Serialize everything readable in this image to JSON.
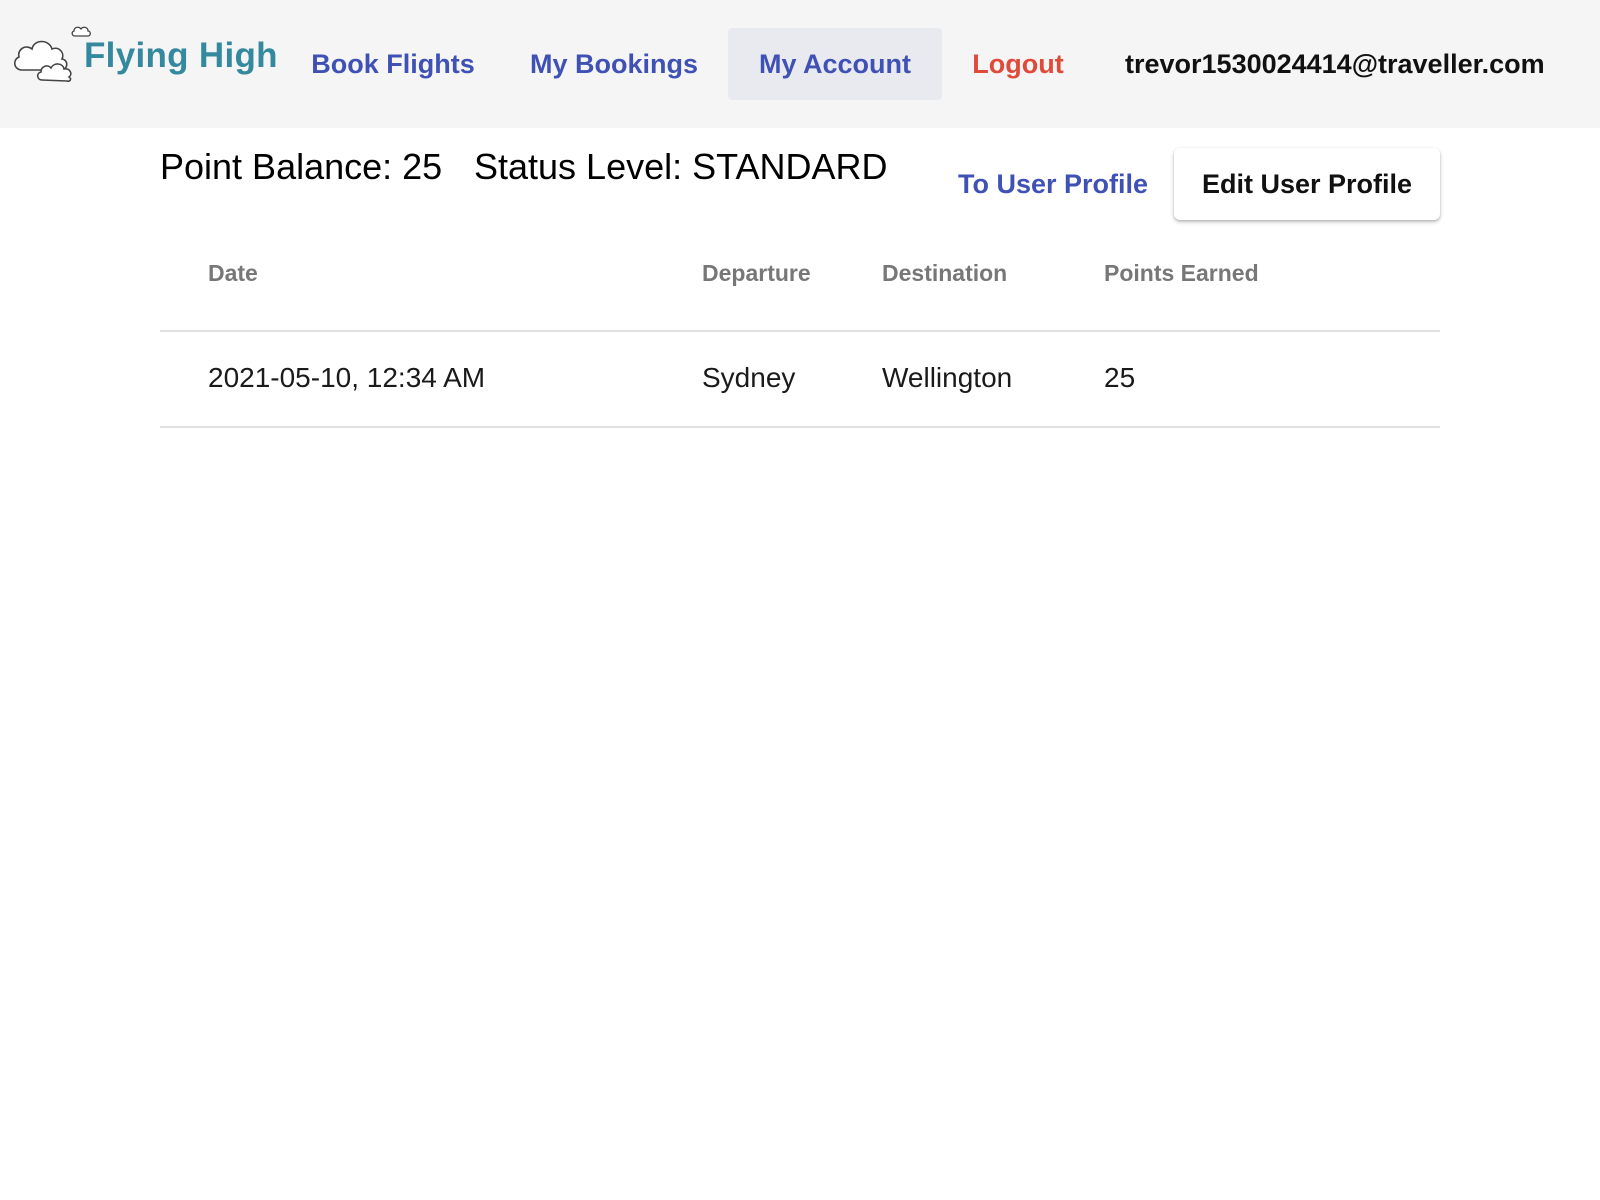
{
  "header": {
    "logo_text": "Flying High",
    "nav": [
      {
        "label": "Book Flights",
        "active": false
      },
      {
        "label": "My Bookings",
        "active": false
      },
      {
        "label": "My Account",
        "active": true
      },
      {
        "label": "Logout",
        "active": false
      }
    ],
    "user_email": "trevor1530024414@traveller.com"
  },
  "account": {
    "point_balance": "Point Balance: 25",
    "status_level": "Status Level: STANDARD",
    "to_profile_label": "To User Profile",
    "edit_profile_label": "Edit User Profile"
  },
  "table": {
    "columns": [
      "Date",
      "Departure",
      "Destination",
      "Points Earned"
    ],
    "rows": [
      [
        "2021-05-10, 12:34 AM",
        "Sydney",
        "Wellington",
        "25"
      ]
    ]
  },
  "colors": {
    "nav_link": "#3f51b5",
    "logout": "#e04a3a",
    "logo": "#34899e",
    "topbar_bg": "#f5f5f5",
    "active_nav_bg": "#e8eaf0"
  }
}
